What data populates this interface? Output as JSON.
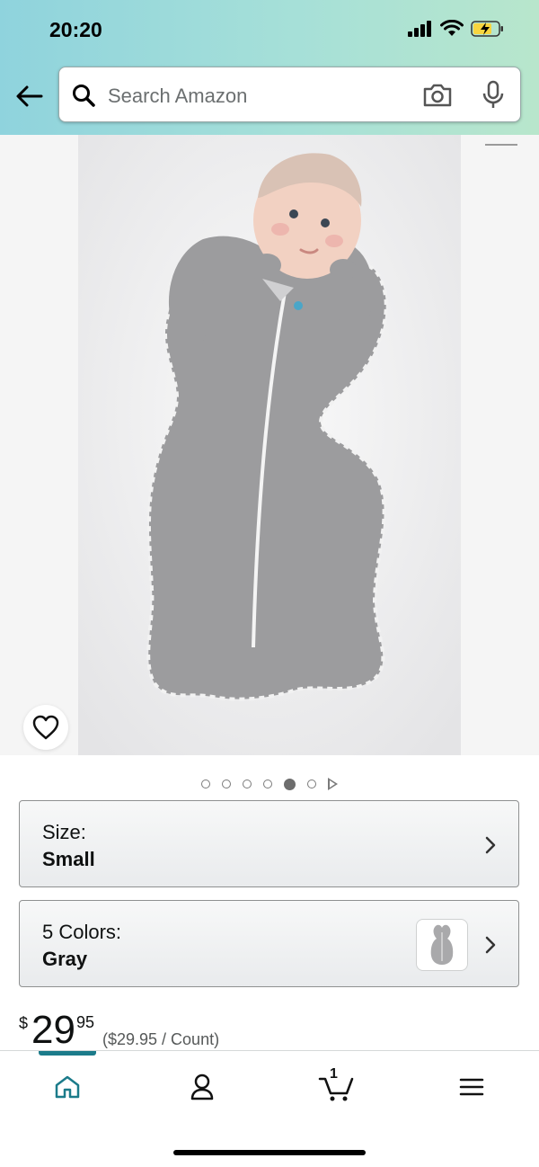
{
  "status": {
    "time": "20:20"
  },
  "search": {
    "placeholder": "Search Amazon"
  },
  "product": {
    "image_indicators": {
      "count": 6,
      "active_index": 4
    }
  },
  "options": [
    {
      "label": "Size:",
      "value": "Small"
    },
    {
      "label": "5 Colors:",
      "value": "Gray"
    }
  ],
  "price": {
    "currency": "$",
    "whole": "29",
    "fraction": "95",
    "per_unit": "($29.95 / Count)"
  },
  "nav": {
    "cart_count": "1"
  },
  "colors": {
    "accent": "#1b7b8a",
    "header_start": "#8fd3dd",
    "header_end": "#b8e6cc"
  }
}
